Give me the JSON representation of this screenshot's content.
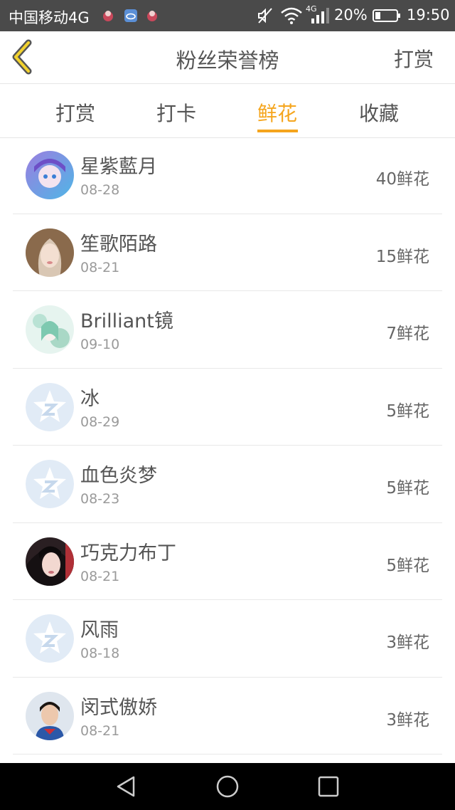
{
  "status_bar": {
    "carrier": "中国移动4G",
    "network": "4G",
    "battery": "20%",
    "time": "19:50"
  },
  "header": {
    "title": "粉丝荣誉榜",
    "action_label": "打赏",
    "back_icon": "chevron-left-icon",
    "accent_color": "#f5a51d"
  },
  "tabs": [
    {
      "label": "打赏",
      "active": false
    },
    {
      "label": "打卡",
      "active": false
    },
    {
      "label": "鲜花",
      "active": true
    },
    {
      "label": "收藏",
      "active": false
    }
  ],
  "fans": [
    {
      "name": "星紫藍月",
      "date": "08-28",
      "amount": "40鲜花",
      "avatar": "anime-avatar"
    },
    {
      "name": "笙歌陌路",
      "date": "08-21",
      "amount": "15鲜花",
      "avatar": "portrait-avatar"
    },
    {
      "name": "Brilliant镜",
      "date": "09-10",
      "amount": "7鲜花",
      "avatar": "anime-avatar"
    },
    {
      "name": "冰",
      "date": "08-29",
      "amount": "5鲜花",
      "avatar": "default-avatar"
    },
    {
      "name": "血色炎梦",
      "date": "08-23",
      "amount": "5鲜花",
      "avatar": "default-avatar"
    },
    {
      "name": "巧克力布丁",
      "date": "08-21",
      "amount": "5鲜花",
      "avatar": "portrait-avatar"
    },
    {
      "name": "风雨",
      "date": "08-18",
      "amount": "3鲜花",
      "avatar": "default-avatar"
    },
    {
      "name": "闵式傲娇",
      "date": "08-21",
      "amount": "3鲜花",
      "avatar": "portrait-avatar"
    }
  ]
}
